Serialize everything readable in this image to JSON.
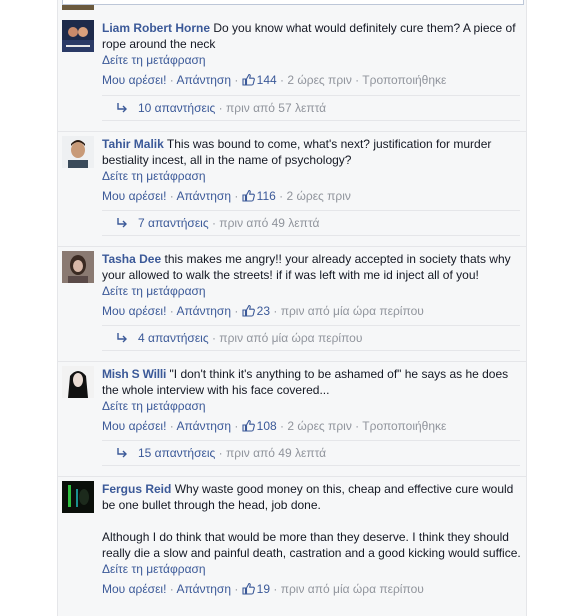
{
  "labels": {
    "translate": "Δείτε τη μετάφραση",
    "like": "Μου αρέσει!",
    "reply": "Απάντηση",
    "sep": " · "
  },
  "comments": [
    {
      "author": "Liam Robert Horne",
      "text": "Do you know what would definitely cure them? A piece of rope around the neck",
      "likes": "144",
      "time": "2 ώρες πριν",
      "edited": "Τροποποιήθηκε",
      "replies_count": "10 απαντήσεις",
      "replies_time": "πριν από 57 λεπτά"
    },
    {
      "author": "Tahir Malik",
      "text": "This was bound to come, what's next? justification for murder bestiality incest, all in the name of psychology?",
      "likes": "116",
      "time": "2 ώρες πριν",
      "replies_count": "7 απαντήσεις",
      "replies_time": "πριν από 49 λεπτά"
    },
    {
      "author": "Tasha Dee",
      "text": "this makes me angry!! your already accepted in society thats why your allowed to walk the streets! if if was left with me id inject all of you!",
      "likes": "23",
      "time": "πριν από μία ώρα περίπου",
      "replies_count": "4 απαντήσεις",
      "replies_time": "πριν από μία ώρα περίπου"
    },
    {
      "author": "Mish S Willi",
      "text": "\"I don't think it's anything to be ashamed of\" he says as he does the whole interview with his face covered...",
      "likes": "108",
      "time": "2 ώρες πριν",
      "edited": "Τροποποιήθηκε",
      "replies_count": "15 απαντήσεις",
      "replies_time": "πριν από 49 λεπτά"
    },
    {
      "author": "Fergus Reid",
      "text": "Why waste good money on this, cheap and effective cure would be one bullet through the head, job done.",
      "text2": "Although I do think that would be more than they deserve. I think they should really die a slow and painful death, castration and a good kicking would suffice.",
      "likes": "19",
      "time": "πριν από μία ώρα περίπου"
    }
  ]
}
